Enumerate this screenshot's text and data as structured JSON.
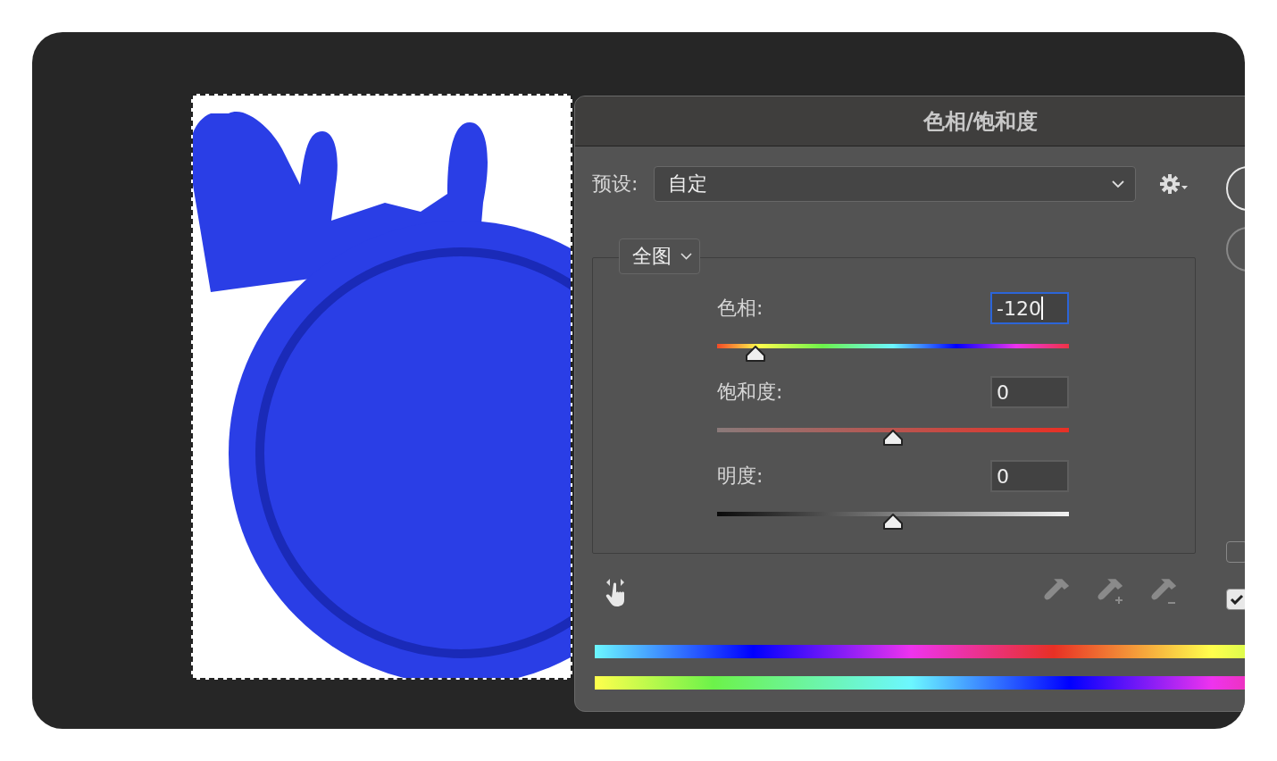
{
  "window": {
    "title": "色相/饱和度"
  },
  "preset": {
    "label": "预设:",
    "value": "自定"
  },
  "channel": {
    "value": "全图"
  },
  "sliders": [
    {
      "kind": "hue",
      "label": "色相:",
      "value": "-120",
      "focused": true,
      "level": 0.11
    },
    {
      "kind": "saturation",
      "label": "饱和度:",
      "value": "0",
      "focused": false,
      "level": 0.5
    },
    {
      "kind": "lightness",
      "label": "明度:",
      "value": "0",
      "focused": false,
      "level": 0.5
    }
  ],
  "options": [
    {
      "checked": false
    },
    {
      "checked": true
    }
  ]
}
